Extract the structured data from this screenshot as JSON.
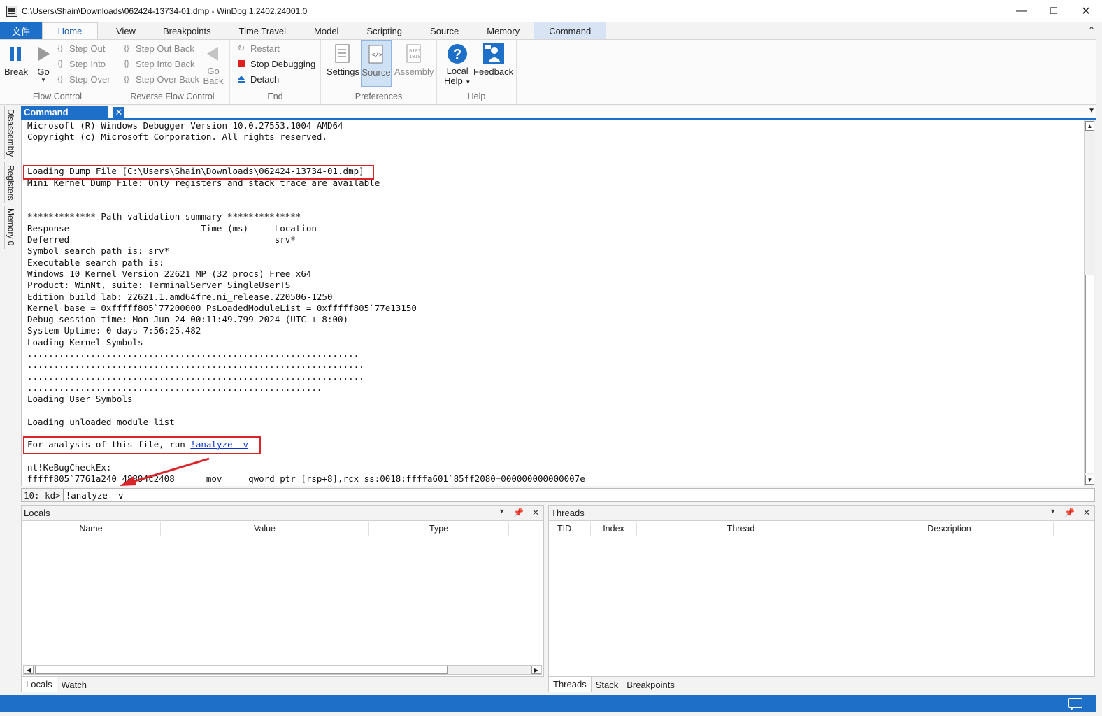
{
  "window": {
    "title": "C:\\Users\\Shain\\Downloads\\062424-13734-01.dmp - WinDbg 1.2402.24001.0"
  },
  "ribbon_tabs": [
    "文件",
    "Home",
    "View",
    "Breakpoints",
    "Time Travel",
    "Model",
    "Scripting",
    "Source",
    "Memory",
    "Command"
  ],
  "ribbon": {
    "flow_control": {
      "label": "Flow Control",
      "break": "Break",
      "go": "Go",
      "step_out": "Step Out",
      "step_into": "Step Into",
      "step_over": "Step Over"
    },
    "reverse_flow_control": {
      "label": "Reverse Flow Control",
      "step_out_back": "Step Out Back",
      "step_into_back": "Step Into Back",
      "step_over_back": "Step Over Back",
      "go_back_1": "Go",
      "go_back_2": "Back"
    },
    "end": {
      "label": "End",
      "restart": "Restart",
      "stop_debugging": "Stop Debugging",
      "detach": "Detach"
    },
    "preferences": {
      "label": "Preferences",
      "settings": "Settings",
      "source": "Source",
      "assembly": "Assembly"
    },
    "help": {
      "label": "Help",
      "local_help_1": "Local",
      "local_help_2": "Help",
      "feedback": "Feedback"
    }
  },
  "side_tabs": [
    "Disassembly",
    "Registers",
    "Memory 0"
  ],
  "command_pane": {
    "tab_label": "Command",
    "output_lines": [
      "Microsoft (R) Windows Debugger Version 10.0.27553.1004 AMD64",
      "Copyright (c) Microsoft Corporation. All rights reserved.",
      "",
      "",
      "Loading Dump File [C:\\Users\\Shain\\Downloads\\062424-13734-01.dmp]",
      "Mini Kernel Dump File: Only registers and stack trace are available",
      "",
      "",
      "************* Path validation summary **************",
      "Response                         Time (ms)     Location",
      "Deferred                                       srv*",
      "Symbol search path is: srv*",
      "Executable search path is: ",
      "Windows 10 Kernel Version 22621 MP (32 procs) Free x64",
      "Product: WinNt, suite: TerminalServer SingleUserTS",
      "Edition build lab: 22621.1.amd64fre.ni_release.220506-1250",
      "Kernel base = 0xfffff805`77200000 PsLoadedModuleList = 0xfffff805`77e13150",
      "Debug session time: Mon Jun 24 00:11:49.799 2024 (UTC + 8:00)",
      "System Uptime: 0 days 7:56:25.482",
      "Loading Kernel Symbols",
      "...............................................................",
      "................................................................",
      "................................................................",
      "........................................................",
      "Loading User Symbols",
      "",
      "Loading unloaded module list",
      "",
      "",
      "nt!KeBugCheckEx:",
      "fffff805`7761a240 48894c2408      mov     qword ptr [rsp+8],rcx ss:0018:ffffa601`85ff2080=000000000000007e"
    ],
    "analysis_prefix": "For analysis of this file, run ",
    "analysis_link": "!analyze -v",
    "prompt": "10: kd>",
    "input_value": "!analyze -v"
  },
  "locals_pane": {
    "title": "Locals",
    "columns": [
      "Name",
      "Value",
      "Type"
    ],
    "tabs": [
      "Locals",
      "Watch"
    ]
  },
  "threads_pane": {
    "title": "Threads",
    "columns": [
      "TID",
      "Index",
      "Thread",
      "Description"
    ],
    "tabs": [
      "Threads",
      "Stack",
      "Breakpoints"
    ]
  },
  "colors": {
    "accent": "#1e6fc7",
    "highlight_box": "#d9242a",
    "link": "#0b36d4"
  }
}
